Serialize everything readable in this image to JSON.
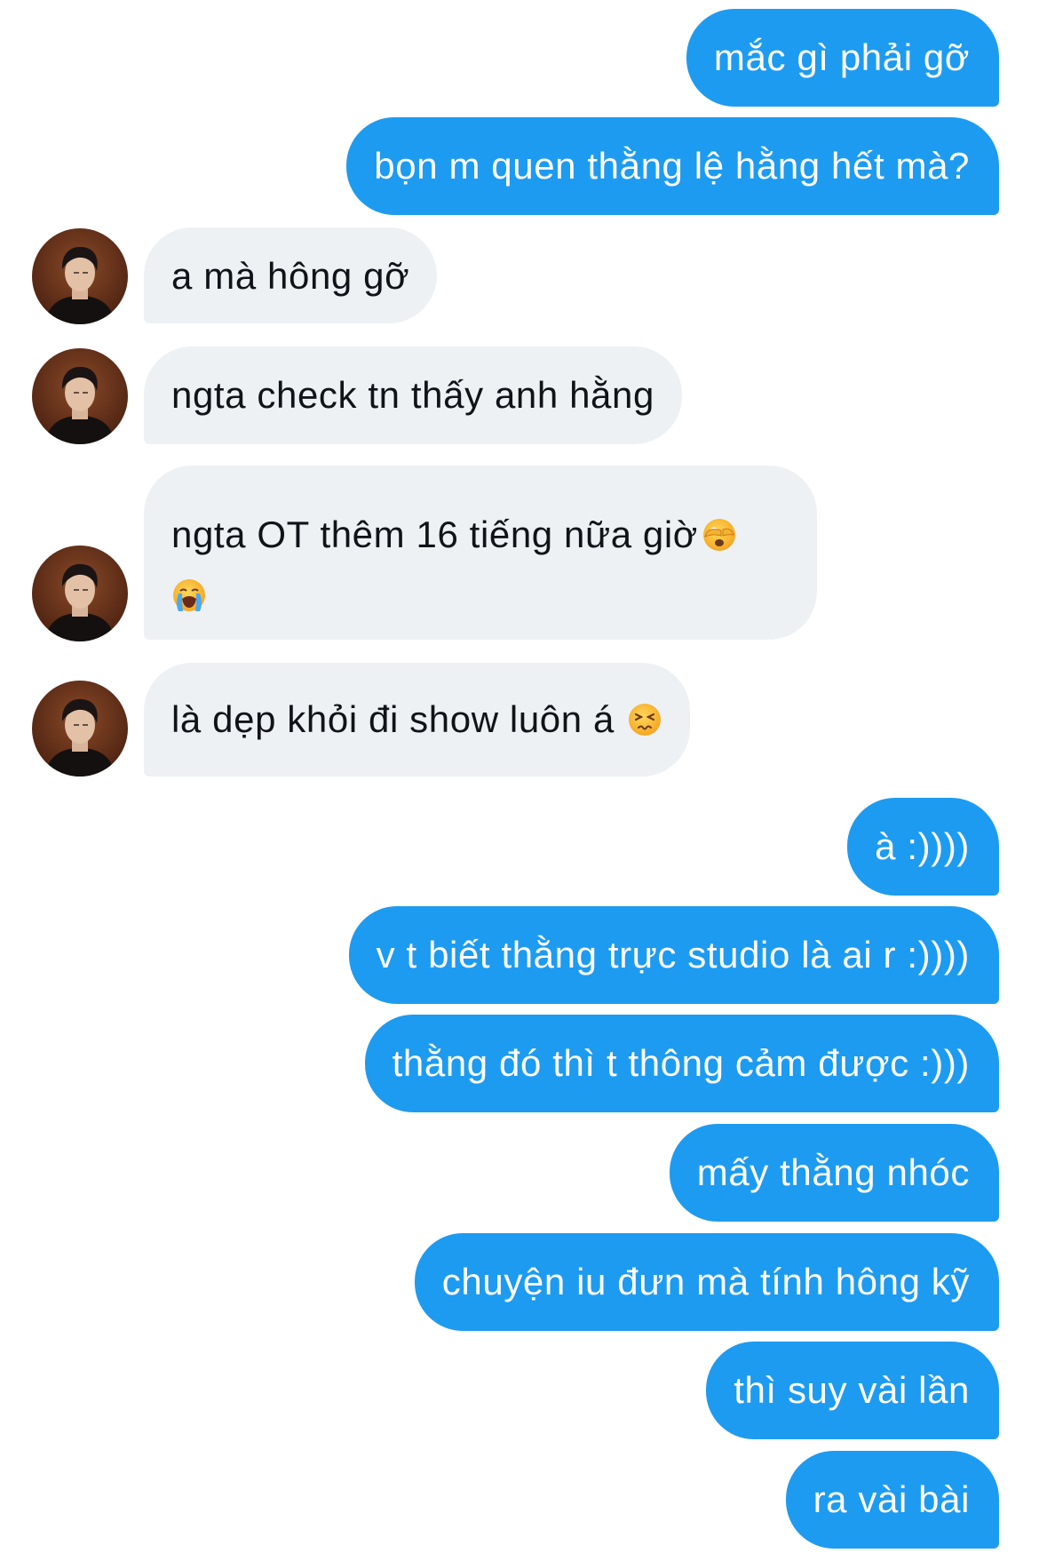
{
  "thread": {
    "colors": {
      "sent_bubble": "#1d9bf0",
      "received_bubble": "#eef1f4",
      "sent_text": "#ffffff",
      "received_text": "#0f1419"
    },
    "messages": [
      {
        "direction": "sent",
        "text": "mắc gì phải gỡ"
      },
      {
        "direction": "sent",
        "text": "bọn m quen thằng lệ hằng hết mà?"
      },
      {
        "direction": "received",
        "text": "a mà hông gỡ"
      },
      {
        "direction": "received",
        "text": "ngta check tn thấy anh hằng"
      },
      {
        "direction": "received",
        "line1": "ngta OT thêm 16 tiếng nữa giờ",
        "emojis": [
          "face-with-peeking-eye-emoji",
          "loudly-crying-face-emoji"
        ]
      },
      {
        "direction": "received",
        "text": "là dẹp khỏi đi show luôn á",
        "emojis": [
          "persevering-face-emoji"
        ]
      },
      {
        "direction": "sent",
        "text": "à :))))"
      },
      {
        "direction": "sent",
        "text": "v t biết thằng trực studio là ai r :))))"
      },
      {
        "direction": "sent",
        "text": "thằng đó thì t thông cảm được :)))"
      },
      {
        "direction": "sent",
        "text": "mấy thằng nhóc"
      },
      {
        "direction": "sent",
        "text": "chuyện iu đưn mà tính hông kỹ"
      },
      {
        "direction": "sent",
        "text": "thì suy vài lần"
      },
      {
        "direction": "sent",
        "text": "ra vài bài"
      }
    ],
    "avatar_icon": "user-avatar-photo"
  }
}
